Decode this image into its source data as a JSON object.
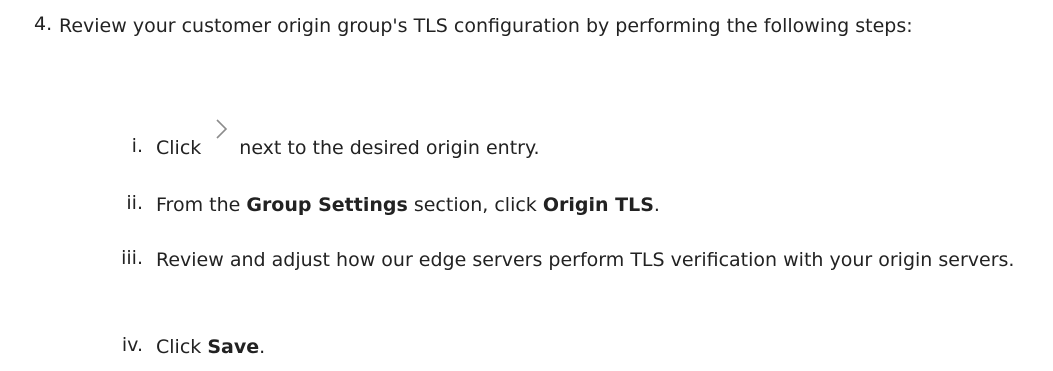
{
  "step": {
    "number": "4.",
    "text": "Review your customer origin group's TLS configuration by performing the following steps:"
  },
  "substeps": [
    {
      "numeral": "i.",
      "before": "Click",
      "icon": "chevron-right-icon",
      "after": "next to the desired origin entry."
    },
    {
      "numeral": "ii.",
      "before": "From the ",
      "bold1": "Group Settings",
      "middle": " section, click ",
      "bold2": "Origin TLS",
      "after": "."
    },
    {
      "numeral": "iii.",
      "text": "Review and adjust how our edge servers perform TLS verification with your origin servers."
    },
    {
      "numeral": "iv.",
      "before": "Click ",
      "bold": "Save",
      "after": "."
    }
  ],
  "colors": {
    "text": "#222222",
    "icon": "#8c8c8c"
  }
}
